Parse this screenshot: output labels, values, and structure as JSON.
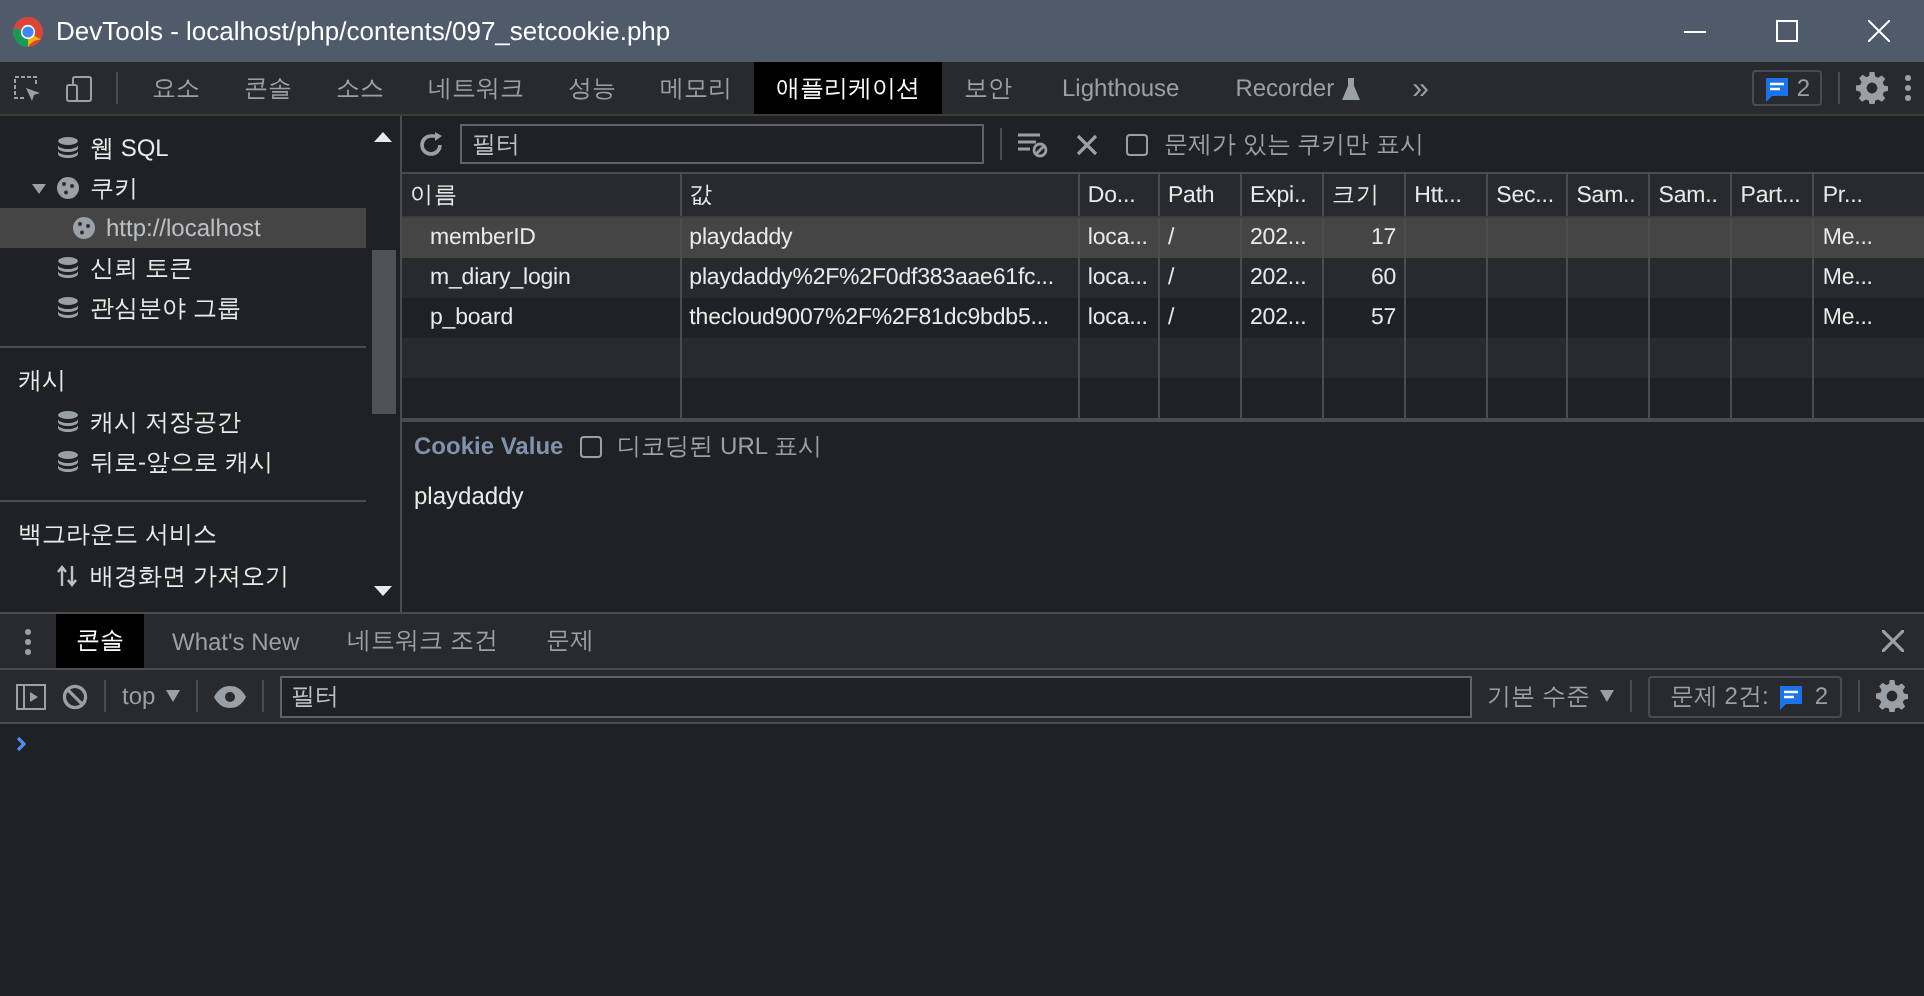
{
  "window": {
    "title": "DevTools - localhost/php/contents/097_setcookie.php"
  },
  "tabs": [
    {
      "label": "요소",
      "selected": false
    },
    {
      "label": "콘솔",
      "selected": false
    },
    {
      "label": "소스",
      "selected": false
    },
    {
      "label": "네트워크",
      "selected": false
    },
    {
      "label": "성능",
      "selected": false
    },
    {
      "label": "메모리",
      "selected": false
    },
    {
      "label": "애플리케이션",
      "selected": true
    },
    {
      "label": "보안",
      "selected": false
    },
    {
      "label": "Lighthouse",
      "selected": false
    },
    {
      "label": "Recorder",
      "selected": false,
      "experimental": true
    }
  ],
  "tabs_overflow": "»",
  "issues_badge": "2",
  "sidebar": {
    "sections": [
      {
        "items": [
          {
            "label": "웹 SQL",
            "kind": "database",
            "selected": false
          },
          {
            "label": "쿠키",
            "kind": "cookie",
            "selected": false,
            "expanded": true,
            "children": [
              {
                "label": "http://localhost",
                "kind": "cookie",
                "selected": true
              }
            ]
          },
          {
            "label": "신뢰 토큰",
            "kind": "database",
            "selected": false
          },
          {
            "label": "관심분야 그룹",
            "kind": "database",
            "selected": false
          }
        ]
      },
      {
        "title": "캐시",
        "items": [
          {
            "label": "캐시 저장공간",
            "kind": "database",
            "selected": false
          },
          {
            "label": "뒤로-앞으로 캐시",
            "kind": "database",
            "selected": false
          }
        ]
      },
      {
        "title": "백그라운드 서비스",
        "items": [
          {
            "label": "배경화면 가져오기",
            "kind": "arrows",
            "selected": false
          }
        ]
      }
    ]
  },
  "toolbar": {
    "filter": {
      "placeholder": "필터"
    },
    "only_issues": {
      "label": "문제가 있는 쿠키만 표시",
      "checked": false
    }
  },
  "table": {
    "columns": [
      "이름",
      "값",
      "Do...",
      "Path",
      "Expi..",
      "크기",
      "Htt...",
      "Sec...",
      "Sam..",
      "Sam..",
      "Part...",
      "Pr..."
    ],
    "rows": [
      {
        "selected": true,
        "cells": [
          "memberID",
          "playdaddy",
          "loca...",
          "/",
          "202...",
          "17",
          "",
          "",
          "",
          "",
          "",
          "Me..."
        ]
      },
      {
        "selected": false,
        "cells": [
          "m_diary_login",
          "playdaddy%2F%2F0df383aae61fc...",
          "loca...",
          "/",
          "202...",
          "60",
          "",
          "",
          "",
          "",
          "",
          "Me..."
        ]
      },
      {
        "selected": false,
        "cells": [
          "p_board",
          "thecloud9007%2F%2F81dc9bdb5...",
          "loca...",
          "/",
          "202...",
          "57",
          "",
          "",
          "",
          "",
          "",
          "Me..."
        ]
      }
    ]
  },
  "cookie_value": {
    "title": "Cookie Value",
    "decode": {
      "label": "디코딩된 URL 표시",
      "checked": false
    },
    "value": "playdaddy"
  },
  "drawer": {
    "tabs": [
      {
        "label": "콘솔",
        "selected": true
      },
      {
        "label": "What's New",
        "selected": false
      },
      {
        "label": "네트워크 조건",
        "selected": false
      },
      {
        "label": "문제",
        "selected": false
      }
    ],
    "context": "top",
    "filter": {
      "placeholder": "필터"
    },
    "levels": "기본 수준",
    "issues_label": "문제 2건:",
    "issues_count": "2"
  }
}
